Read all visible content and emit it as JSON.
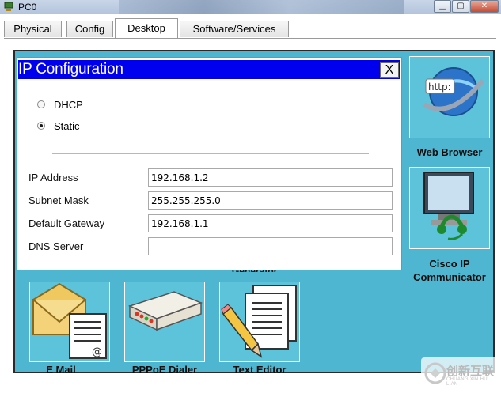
{
  "window": {
    "title": "PC0"
  },
  "tabs": [
    {
      "label": "Physical"
    },
    {
      "label": "Config"
    },
    {
      "label": "Desktop"
    },
    {
      "label": "Software/Services"
    }
  ],
  "active_tab": "Desktop",
  "ip_config": {
    "title": "IP Configuration",
    "close_label": "X",
    "radio_options": [
      {
        "label": "DHCP",
        "selected": false
      },
      {
        "label": "Static",
        "selected": true
      }
    ],
    "fields": [
      {
        "label": "IP Address",
        "value": "192.168.1.2"
      },
      {
        "label": "Subnet Mask",
        "value": "255.255.255.0"
      },
      {
        "label": "Default Gateway",
        "value": "192.168.1.1"
      },
      {
        "label": "DNS Server",
        "value": ""
      }
    ]
  },
  "desktop_apps": {
    "web_browser": {
      "label": "Web Browser",
      "icon": "web-browser-icon",
      "icon_text": "http:"
    },
    "cisco_ip_communicator": {
      "label_line1": "Cisco IP",
      "label_line2": "Communicator",
      "icon": "ip-communicator-icon"
    },
    "email": {
      "label": "E Mail",
      "icon": "email-icon"
    },
    "pppoe_dialer": {
      "label": "PPPoE Dialer",
      "icon": "pppoe-dialer-icon"
    },
    "text_editor": {
      "label": "Text Editor",
      "icon": "text-editor-icon"
    },
    "hidden_app_label_fragment": "Generator"
  },
  "watermark": {
    "text": "创新互联",
    "sub": "CHUANG XIN HU LIAN"
  },
  "colors": {
    "desktop_bg": "#4eb6d0",
    "dialog_title_bg": "#0000ee",
    "tile_bg": "#5cc3db"
  }
}
